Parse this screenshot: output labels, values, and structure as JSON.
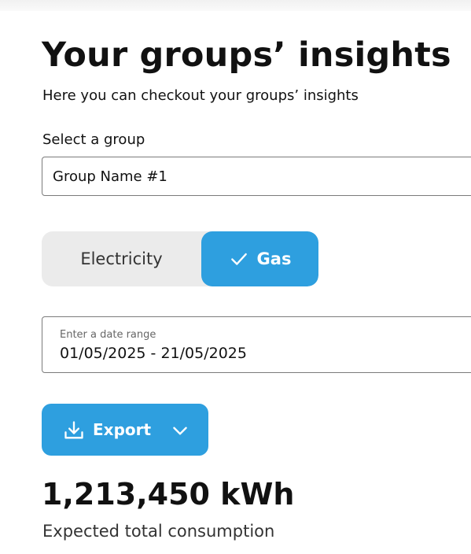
{
  "header": {
    "title": "Your groups’ insights",
    "subtitle": "Here you can checkout your groups’ insights"
  },
  "group_select": {
    "label": "Select a group",
    "value": "Group Name #1"
  },
  "energy_toggle": {
    "options": [
      {
        "label": "Electricity",
        "selected": false
      },
      {
        "label": "Gas",
        "selected": true
      }
    ]
  },
  "date_range": {
    "label": "Enter a date range",
    "value": "01/05/2025 - 21/05/2025"
  },
  "export": {
    "label": "Export"
  },
  "metric": {
    "value": "1,213,450 kWh",
    "caption": "Expected total consumption"
  },
  "icons": {
    "check": "check-icon",
    "download": "download-icon",
    "chevron": "chevron-down-icon"
  },
  "colors": {
    "accent": "#2e9fdf",
    "toggle_bg": "#ebebeb",
    "border": "#7b7b7b"
  }
}
